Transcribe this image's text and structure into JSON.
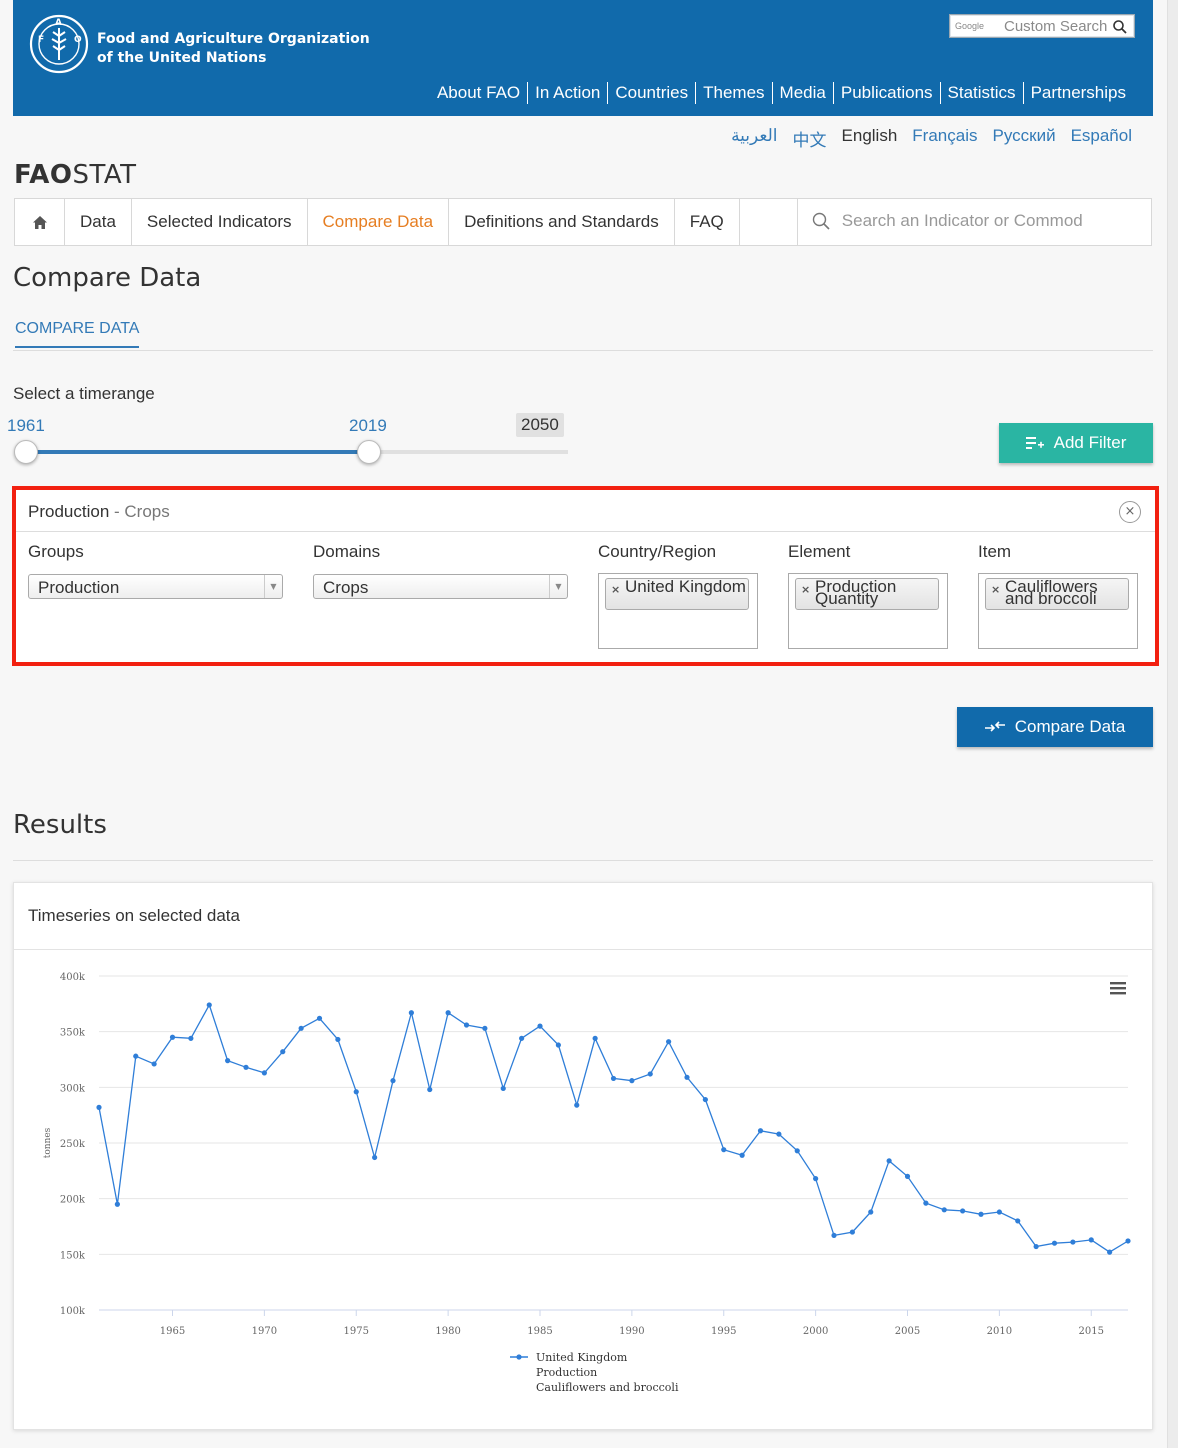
{
  "header": {
    "org_name_line1": "Food and Agriculture Organization",
    "org_name_line2": "of the United Nations",
    "google_label": "Google",
    "search_placeholder": "Custom Search",
    "nav": [
      "About FAO",
      "In Action",
      "Countries",
      "Themes",
      "Media",
      "Publications",
      "Statistics",
      "Partnerships"
    ],
    "brand_color": "#116aab"
  },
  "languages": {
    "items": [
      "العربية",
      "中文",
      "English",
      "Français",
      "Русский",
      "Español"
    ],
    "active": "English"
  },
  "app_title": {
    "bold": "FAO",
    "rest": "STAT"
  },
  "main_nav": {
    "tabs": [
      "Data",
      "Selected Indicators",
      "Compare Data",
      "Definitions and Standards",
      "FAQ"
    ],
    "active": "Compare Data",
    "search_placeholder": "Search an Indicator or Commodity"
  },
  "page": {
    "title": "Compare Data",
    "subtab": "COMPARE DATA"
  },
  "timerange": {
    "label": "Select a timerange",
    "from": "1961",
    "to": "2019",
    "max": "2050"
  },
  "buttons": {
    "add_filter": "Add Filter",
    "compare": "Compare Data",
    "add_filter_color": "#2ab5a3",
    "compare_color": "#116aab"
  },
  "filter": {
    "title": "Production",
    "separator": " - ",
    "subtitle": "Crops",
    "labels": {
      "groups": "Groups",
      "domains": "Domains",
      "country": "Country/Region",
      "element": "Element",
      "item": "Item"
    },
    "groups_value": "Production",
    "domains_value": "Crops",
    "country_value": "United Kingdom",
    "element_value": "Production Quantity",
    "item_value": "Cauliflowers and broccoli",
    "highlight_color": "#f22010"
  },
  "results": {
    "title": "Results",
    "panel_title": "Timeseries on selected data"
  },
  "chart_data": {
    "type": "line",
    "ylabel": "tonnes",
    "ylim": [
      100000,
      400000
    ],
    "y_ticks": [
      100000,
      150000,
      200000,
      250000,
      300000,
      350000,
      400000
    ],
    "y_tick_labels": [
      "100k",
      "150k",
      "200k",
      "250k",
      "300k",
      "350k",
      "400k"
    ],
    "x_ticks": [
      1965,
      1970,
      1975,
      1980,
      1985,
      1990,
      1995,
      2000,
      2005,
      2010,
      2015
    ],
    "xlim": [
      1961,
      2017
    ],
    "grid": "horizontal",
    "legend_position": "bottom-left",
    "series": [
      {
        "legend_lines": [
          "United Kingdom",
          "Production",
          "Cauliflowers and broccoli"
        ],
        "color": "#2f7ed8",
        "x": [
          1961,
          1962,
          1963,
          1964,
          1965,
          1966,
          1967,
          1968,
          1969,
          1970,
          1971,
          1972,
          1973,
          1974,
          1975,
          1976,
          1977,
          1978,
          1979,
          1980,
          1981,
          1982,
          1983,
          1984,
          1985,
          1986,
          1987,
          1988,
          1989,
          1990,
          1991,
          1992,
          1993,
          1994,
          1995,
          1996,
          1997,
          1998,
          1999,
          2000,
          2001,
          2002,
          2003,
          2004,
          2005,
          2006,
          2007,
          2008,
          2009,
          2010,
          2011,
          2012,
          2013,
          2014,
          2015,
          2016,
          2017
        ],
        "values": [
          282000,
          195000,
          328000,
          321000,
          345000,
          344000,
          374000,
          324000,
          318000,
          313000,
          332000,
          353000,
          362000,
          343000,
          296000,
          237000,
          306000,
          367000,
          298000,
          367000,
          356000,
          353000,
          299000,
          344000,
          355000,
          338000,
          284000,
          344000,
          308000,
          306000,
          312000,
          341000,
          309000,
          289000,
          244000,
          239000,
          261000,
          258000,
          243000,
          218000,
          167000,
          170000,
          188000,
          234000,
          220000,
          196000,
          190000,
          189000,
          186000,
          188000,
          180000,
          157000,
          160000,
          161000,
          163000,
          152000,
          162000
        ]
      }
    ]
  }
}
